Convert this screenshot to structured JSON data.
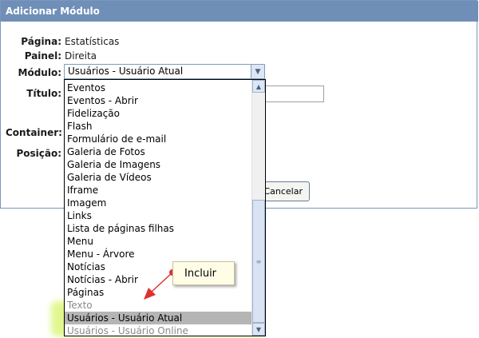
{
  "window": {
    "title": "Adicionar Módulo"
  },
  "form": {
    "pagina_label": "Página:",
    "pagina_value": "Estatísticas",
    "painel_label": "Painel:",
    "painel_value": "Direita",
    "modulo_label": "Módulo:",
    "modulo_selected": "Usuários - Usuário Atual",
    "titulo_label": "Título:",
    "container_label": "Container:",
    "posicao_label": "Posição:",
    "cancel_label": "Cancelar"
  },
  "dropdown": {
    "options": [
      {
        "label": "Eventos",
        "state": "normal"
      },
      {
        "label": "Eventos - Abrir",
        "state": "normal"
      },
      {
        "label": "Fidelização",
        "state": "normal"
      },
      {
        "label": "Flash",
        "state": "normal"
      },
      {
        "label": "Formulário de e-mail",
        "state": "normal"
      },
      {
        "label": "Galeria de Fotos",
        "state": "normal"
      },
      {
        "label": "Galeria de Imagens",
        "state": "normal"
      },
      {
        "label": "Galeria de Vídeos",
        "state": "normal"
      },
      {
        "label": "Iframe",
        "state": "normal"
      },
      {
        "label": "Imagem",
        "state": "normal"
      },
      {
        "label": "Links",
        "state": "normal"
      },
      {
        "label": "Lista de páginas filhas",
        "state": "normal"
      },
      {
        "label": "Menu",
        "state": "normal"
      },
      {
        "label": "Menu - Árvore",
        "state": "normal"
      },
      {
        "label": "Notícias",
        "state": "normal"
      },
      {
        "label": "Notícias - Abrir",
        "state": "normal"
      },
      {
        "label": "Páginas",
        "state": "normal"
      },
      {
        "label": "Texto",
        "state": "dim"
      },
      {
        "label": "Usuários - Usuário Atual",
        "state": "selected"
      },
      {
        "label": "Usuários - Usuário Online",
        "state": "dim"
      }
    ]
  },
  "callout": {
    "label": "Incluir"
  },
  "colors": {
    "titlebar": "#6f8fb8",
    "selected": "#b5b5b5",
    "highlight": "#c8f032",
    "arrow": "#e03030"
  }
}
